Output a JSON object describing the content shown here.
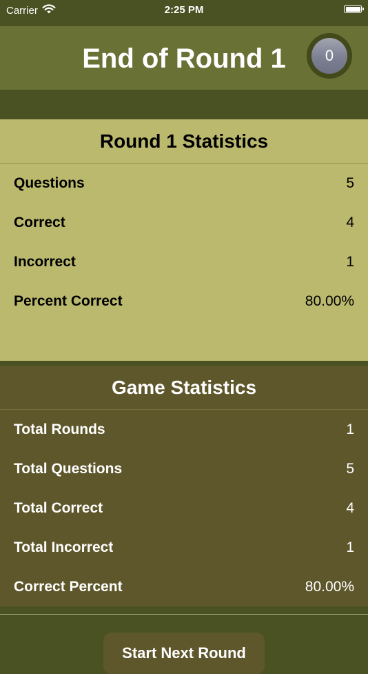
{
  "status_bar": {
    "carrier": "Carrier",
    "time": "2:25 PM"
  },
  "nav": {
    "title": "End of Round 1",
    "score": "0"
  },
  "round_stats": {
    "title": "Round 1 Statistics",
    "rows": [
      {
        "label": "Questions",
        "value": "5"
      },
      {
        "label": "Correct",
        "value": "4"
      },
      {
        "label": "Incorrect",
        "value": "1"
      },
      {
        "label": "Percent Correct",
        "value": "80.00%"
      }
    ]
  },
  "game_stats": {
    "title": "Game Statistics",
    "rows": [
      {
        "label": "Total Rounds",
        "value": "1"
      },
      {
        "label": "Total Questions",
        "value": "5"
      },
      {
        "label": "Total Correct",
        "value": "4"
      },
      {
        "label": "Total Incorrect",
        "value": "1"
      },
      {
        "label": "Correct Percent",
        "value": "80.00%"
      }
    ]
  },
  "actions": {
    "next_round_label": "Start Next Round"
  },
  "colors": {
    "background": "#4a5223",
    "nav_bar": "#6a7135",
    "round_panel": "#bbb96e",
    "game_panel": "#5e572b",
    "score_badge": "#7d8093"
  },
  "icons": {
    "signal": "wifi-icon",
    "battery": "battery-icon"
  }
}
